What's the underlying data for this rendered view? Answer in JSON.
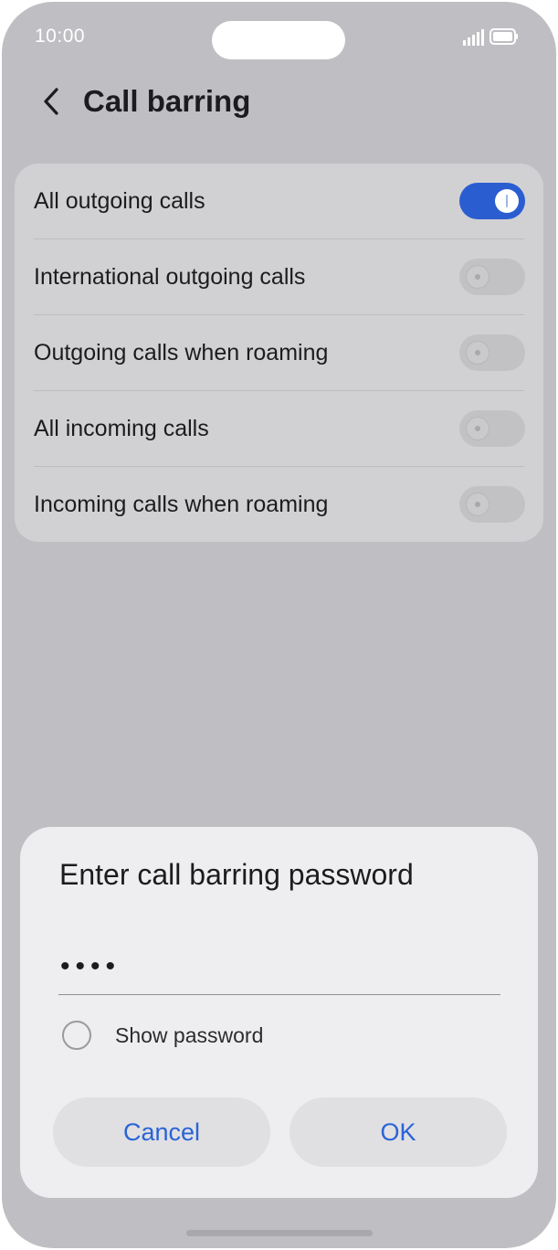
{
  "status_bar": {
    "time": "10:00"
  },
  "header": {
    "title": "Call barring"
  },
  "settings": [
    {
      "label": "All outgoing calls",
      "enabled": true
    },
    {
      "label": "International outgoing calls",
      "enabled": false
    },
    {
      "label": "Outgoing calls when roaming",
      "enabled": false
    },
    {
      "label": "All incoming calls",
      "enabled": false
    },
    {
      "label": "Incoming calls when roaming",
      "enabled": false
    }
  ],
  "dialog": {
    "title": "Enter call barring password",
    "password_masked": "••••",
    "show_password_label": "Show password",
    "show_password_checked": false,
    "cancel_label": "Cancel",
    "ok_label": "OK"
  },
  "colors": {
    "accent": "#2a63d6",
    "toggle_on": "#2a5dd0"
  }
}
